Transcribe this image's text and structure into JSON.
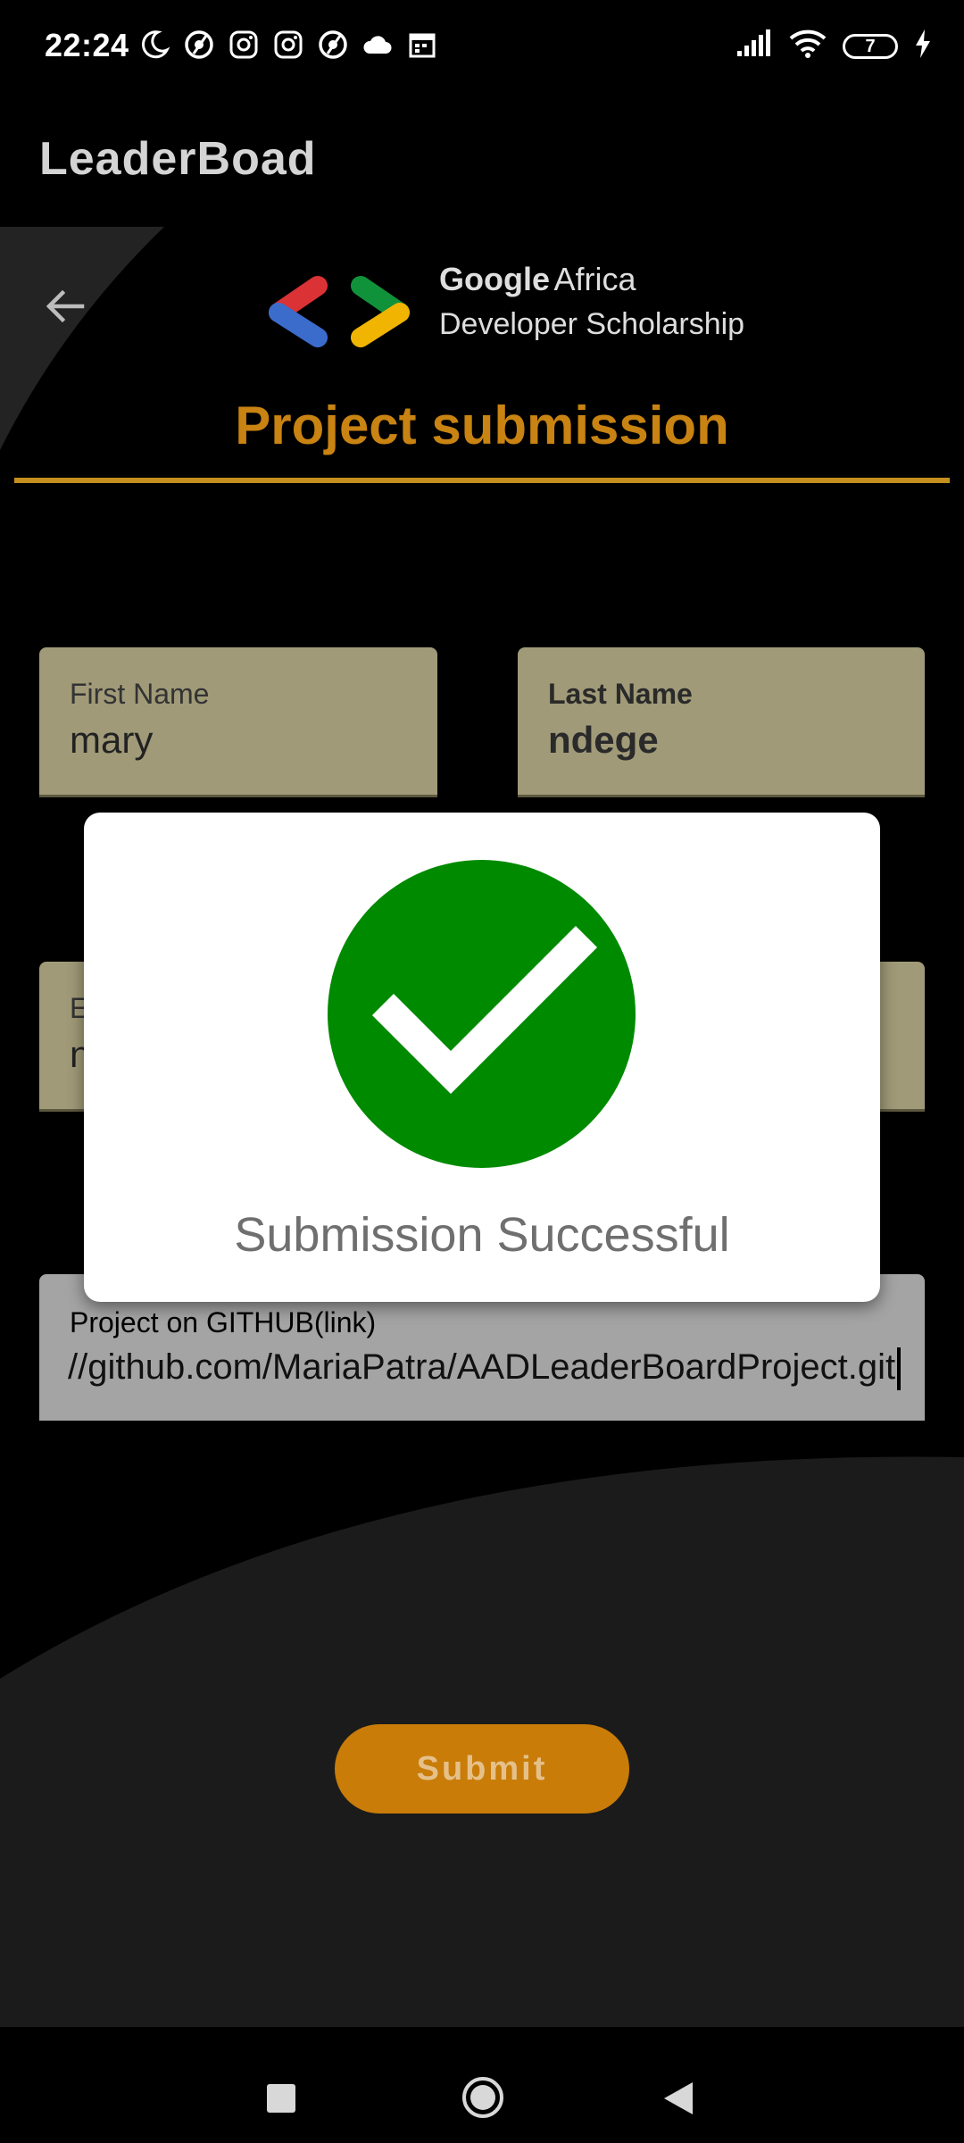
{
  "status_bar": {
    "time": "22:24",
    "battery_level": "7",
    "left_icons": [
      "moon-icon",
      "sync-icon",
      "instagram-icon",
      "instagram-icon",
      "sync-icon",
      "cloud-icon",
      "calendar-icon"
    ],
    "right_icons": [
      "signal-icon",
      "wifi-icon",
      "battery-icon",
      "charging-icon"
    ]
  },
  "app_bar": {
    "title": "LeaderBoad"
  },
  "header": {
    "back_icon": "arrow-back-icon",
    "logo_google": "Google",
    "logo_africa": "Africa",
    "logo_line2": "Developer Scholarship",
    "page_title": "Project submission"
  },
  "form": {
    "first_name": {
      "label": "First Name",
      "value": "mary"
    },
    "last_name": {
      "label": "Last Name",
      "value": "ndege"
    },
    "email": {
      "label": "E",
      "value": "n"
    },
    "github": {
      "label": "Project on GITHUB(link)",
      "value": "//github.com/MariaPatra/AADLeaderBoardProject.git"
    },
    "submit_label": "Submit"
  },
  "dialog": {
    "icon": "check-circle-icon",
    "message": "Submission Successful"
  },
  "colors": {
    "accent": "#c88312",
    "success_green": "#008a00",
    "field_bg": "#a09a78",
    "submit_bg": "#c97c08"
  },
  "nav_bar": {
    "icons": [
      "recents-square-icon",
      "home-circle-icon",
      "back-triangle-icon"
    ]
  }
}
